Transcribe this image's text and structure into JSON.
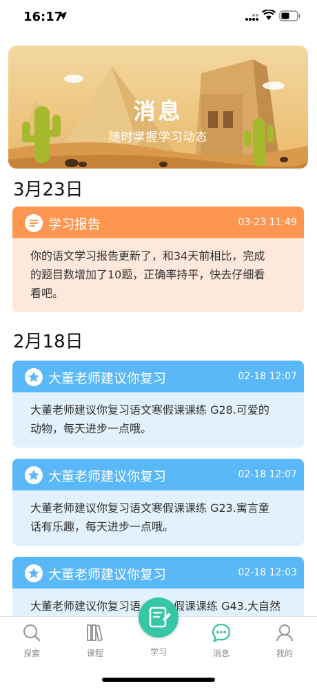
{
  "status_bar": {
    "time": "16:17"
  },
  "banner": {
    "title": "消息",
    "subtitle": "随时掌握学习动态"
  },
  "sections": [
    {
      "date": "3月23日",
      "cards": [
        {
          "icon": "list-icon",
          "title": "学习报告",
          "time": "03-23 11:49",
          "lines": [
            "你的语文学习报告更新了，和34天前相比，完成",
            "的题目数增加了10题，正确率持平，快去仔细看",
            "看吧。"
          ]
        }
      ]
    },
    {
      "date": "2月18日",
      "cards": [
        {
          "icon": "star-icon",
          "title": "大董老师建议你复习",
          "time": "02-18 12:07",
          "lines": [
            "大董老师建议你复习语文寒假课课练 G28.可爱的",
            "动物，每天进步一点哦。"
          ]
        },
        {
          "icon": "star-icon",
          "title": "大董老师建议你复习",
          "time": "02-18 12:07",
          "lines": [
            "大董老师建议你复习语文寒假课课练 G23.寓言童",
            "话有乐趣，每天进步一点哦。"
          ]
        },
        {
          "icon": "star-icon",
          "title": "大董老师建议你复习",
          "time": "02-18 12:03",
          "lines": [
            "大董老师建议你复习语",
            "假课课练 G43.大自然"
          ]
        }
      ]
    }
  ],
  "tabbar": {
    "items": [
      {
        "label": "探索",
        "icon": "search-icon"
      },
      {
        "label": "课程",
        "icon": "books-icon"
      },
      {
        "label": "学习",
        "icon": "pencil-note-icon"
      },
      {
        "label": "消息",
        "icon": "chat-bubble-icon",
        "active": true
      },
      {
        "label": "我的",
        "icon": "user-icon"
      }
    ]
  },
  "colors": {
    "orange_header": "#fd9650",
    "orange_body": "#fde8dc",
    "blue_header": "#5ab8f8",
    "blue_body": "#e3f1fc",
    "active_tab": "#2ec29b",
    "fab": "#35c6a6"
  }
}
